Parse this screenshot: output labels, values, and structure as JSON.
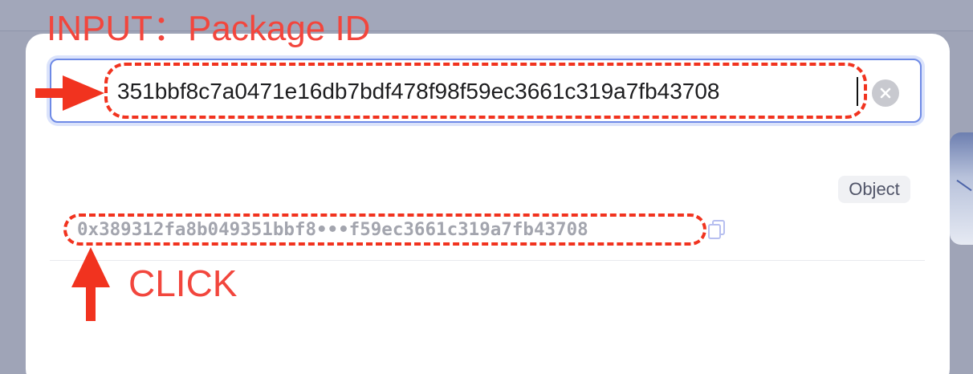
{
  "annotations": {
    "input_label": "INPUT：Package ID",
    "click_label": "CLICK",
    "highlight_color": "#f1331f"
  },
  "search": {
    "value": "351bbf8c7a0471e16db7bdf478f98f59ec3661c319a7fb43708",
    "clear_icon": "close-circle-icon",
    "focus_color": "#6e8ae6"
  },
  "results": [
    {
      "type_badge": "Object",
      "address": "0x389312fa8b049351bbf8•••f59ec3661c319a7fb43708",
      "copy_icon": "copy-icon"
    }
  ]
}
